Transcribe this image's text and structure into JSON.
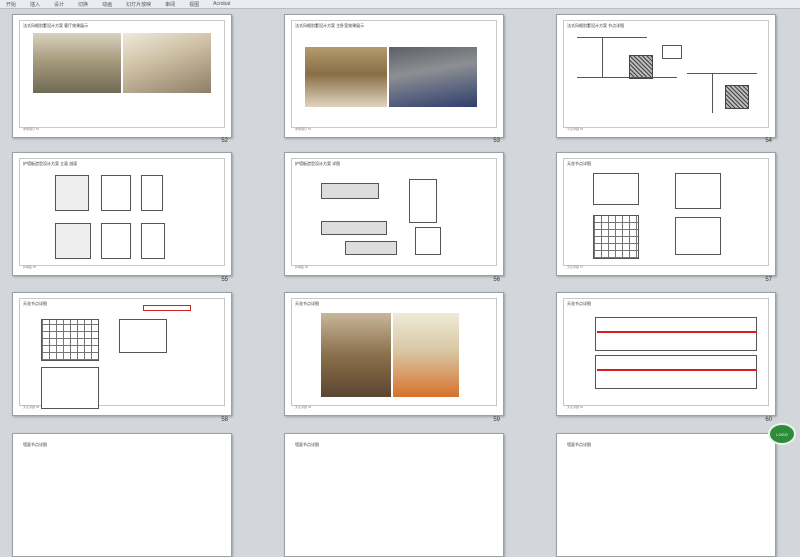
{
  "ribbon": {
    "tabs": [
      "开始",
      "插入",
      "设计",
      "切换",
      "动画",
      "幻灯片放映",
      "审阅",
      "视图",
      "Acrobat"
    ]
  },
  "slides": [
    {
      "title": "法式风格别墅设计方案  客厅效果展示",
      "number": "52",
      "footer": "效果展示  52"
    },
    {
      "title": "法式风格别墅设计方案  主卧室效果展示",
      "number": "53",
      "footer": "效果展示  53"
    },
    {
      "title": "法式风格别墅设计方案  节点详图",
      "number": "54",
      "footer": "节点详图  54"
    },
    {
      "title": "护墙板造型设计方案  立面 剖面",
      "number": "55",
      "footer": "护墙板  55"
    },
    {
      "title": "护墙板造型设计方案  详图",
      "number": "56",
      "footer": "护墙板  56"
    },
    {
      "title": "天花节点详图",
      "number": "57",
      "footer": "天花详图  57"
    },
    {
      "title": "天花节点详图",
      "number": "58",
      "footer": "天花详图  58"
    },
    {
      "title": "天花节点详图",
      "number": "59",
      "footer": "天花详图  59"
    },
    {
      "title": "天花节点详图",
      "number": "60",
      "footer": "天花详图  60"
    },
    {
      "title": "墙面节点详图",
      "number": "",
      "footer": ""
    },
    {
      "title": "墙面节点详图",
      "number": "",
      "footer": ""
    },
    {
      "title": "墙面节点详图",
      "number": "",
      "footer": ""
    }
  ],
  "logo": {
    "text": "LOGO"
  },
  "colors": {
    "background": "#d3d6db",
    "slide": "#ffffff",
    "redline": "#d02020"
  }
}
